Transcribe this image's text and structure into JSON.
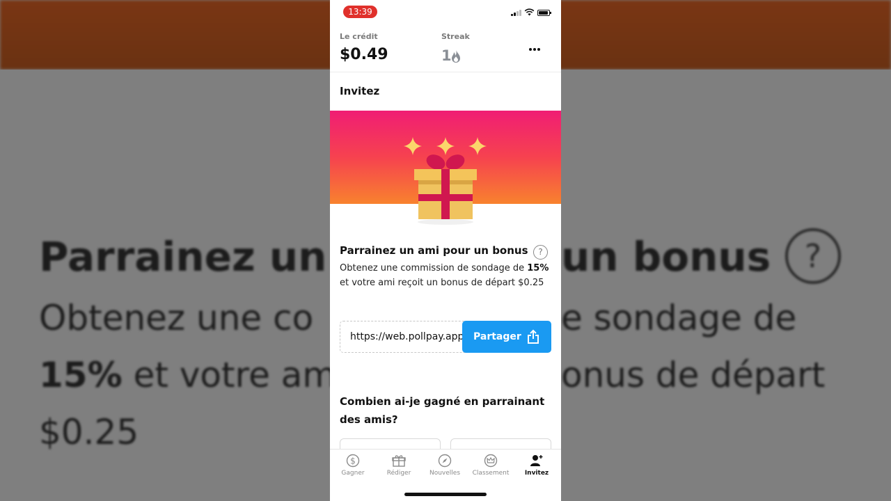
{
  "status": {
    "time": "13:39"
  },
  "header": {
    "credit_label": "Le crédit",
    "credit_value": "$0.49",
    "streak_label": "Streak",
    "streak_value": "1"
  },
  "page": {
    "title": "Invitez"
  },
  "invite": {
    "title": "Parrainez un ami pour un bonus",
    "desc_before": "Obtenez une commission de sondage de ",
    "desc_percent": "15%",
    "desc_after": " et votre ami reçoit un bonus de départ $0.25",
    "link": "https://web.pollpay.app",
    "share_label": "Partager"
  },
  "earned": {
    "title": "Combien ai-je gagné en parrainant des amis?"
  },
  "background": {
    "line1": "Parrainez un",
    "line1_right": "un bonus",
    "line2": "Obtenez une co",
    "line2_right": "e sondage de",
    "line3_bold": "15%",
    "line3": " et votre am",
    "line3_right": "onus de départ",
    "line4": "$0.25"
  },
  "tabs": [
    {
      "label": "Gagner",
      "icon": "dollar-icon"
    },
    {
      "label": "Rédiger",
      "icon": "gift-icon"
    },
    {
      "label": "Nouvelles",
      "icon": "compass-icon"
    },
    {
      "label": "Classement",
      "icon": "crown-icon"
    },
    {
      "label": "Invitez",
      "icon": "add-user-icon",
      "active": true
    }
  ],
  "colors": {
    "accent": "#1a9af2",
    "banner_top": "#f01d74",
    "banner_bottom": "#f8822e",
    "time_pill": "#e0302b"
  }
}
